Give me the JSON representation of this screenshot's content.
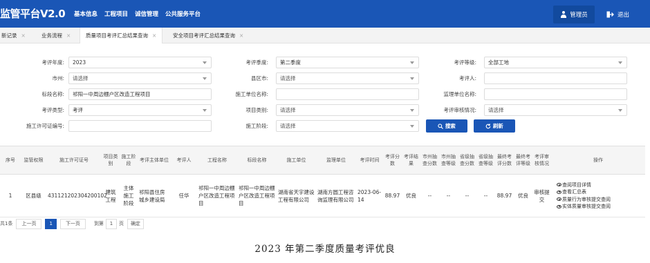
{
  "header": {
    "brand": "监管平台V2.0",
    "menu": [
      "基本信息",
      "工程项目",
      "诚信管理",
      "公共服务平台"
    ],
    "user_label": "管理员",
    "logout_label": "退出"
  },
  "tabs": [
    {
      "label": "新记录"
    },
    {
      "label": "业务流程"
    },
    {
      "label": "质量项目考评汇总结果查询"
    },
    {
      "label": "安全项目考评汇总结果查询"
    }
  ],
  "form": {
    "year_label": "考评年度:",
    "year_value": "2023",
    "quarter_label": "考评季度:",
    "quarter_value": "第二季度",
    "grade_label": "考评等级:",
    "grade_value": "全部工地",
    "city_label": "市州:",
    "city_value": "请选择",
    "county_label": "县区市:",
    "county_value": "请选择",
    "reviewer_label": "考评人:",
    "reviewer_value": "",
    "section_label": "标段名称:",
    "section_value": "祁阳一中周边棚户区改造工程项目",
    "builder_label": "施工单位名称:",
    "builder_value": "",
    "supervisor_label": "监理单位名称:",
    "supervisor_value": "",
    "type_label": "考评类型:",
    "type_value": "考评",
    "category_label": "项目类别:",
    "category_value": "请选择",
    "audit_label": "考评审核情况:",
    "audit_value": "请选择",
    "permit_label": "施工许可证编号:",
    "permit_value": "",
    "stage_label": "施工阶段:",
    "stage_value": "请选择",
    "search_button": "搜索",
    "refresh_button": "刷新"
  },
  "table": {
    "headers": [
      "序号",
      "监管权限",
      "施工许可证号",
      "项目类别",
      "施工阶段",
      "考评主体单位",
      "考评人",
      "工程名称",
      "标段名称",
      "施工单位",
      "监理单位",
      "考评时间",
      "考评分数",
      "考评结果",
      "市州抽查分数",
      "市州抽查等级",
      "省级抽查分数",
      "省级抽查等级",
      "最终考评分数",
      "最终考评等级",
      "考评审核情况",
      "操作"
    ],
    "rows": [
      {
        "index": "1",
        "authority": "区县级",
        "permit": "431121202304200102",
        "category": "建筑工程",
        "stage": "主体施工阶段",
        "org": "祁阳县住房城乡建设局",
        "reviewer": "任华",
        "project": "祁阳一中周边棚户区改造工程项目",
        "section": "祁阳一中周边棚户区改造工程项目",
        "builder": "湖南省天宇建设工程有限公司",
        "supervisor": "湖南方圆工程咨询监理有限公司",
        "date": "2023-06-14",
        "score": "88.97",
        "result": "优良",
        "city_score": "--",
        "city_grade": "--",
        "prov_score": "--",
        "prov_grade": "--",
        "final_score": "88.97",
        "final_grade": "优良",
        "audit": "审核提交",
        "ops": [
          "查阅项目详情",
          "查看汇总表",
          "质量行为审核提交查阅",
          "实体质量审核提交查阅"
        ]
      }
    ]
  },
  "pager": {
    "total": "共1条",
    "prev": "上一页",
    "current": "1",
    "next": "下一页",
    "goto_label": "到第",
    "goto_value": "1",
    "page_unit": "页",
    "confirm": "确定"
  },
  "caption": "2023 年第二季度质量考评优良",
  "colors": {
    "primary": "#1a56b6",
    "highlight": "#e02020"
  }
}
